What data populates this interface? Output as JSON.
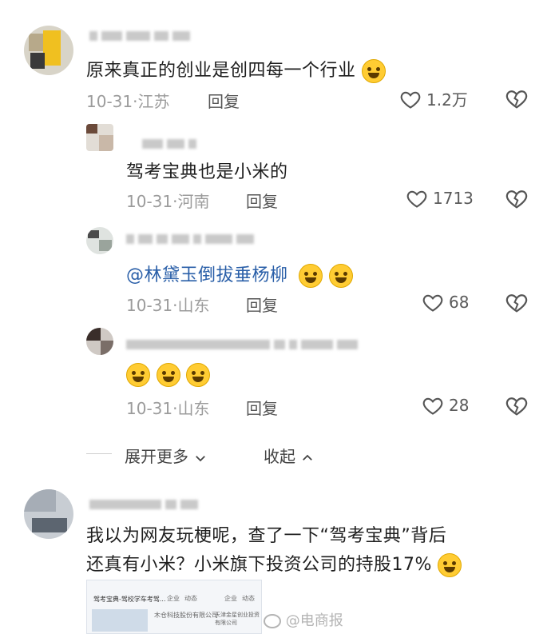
{
  "comments": [
    {
      "text": "原来真正的创业是创四每一个行业",
      "date": "10-31",
      "location": "江苏",
      "reply_label": "回复",
      "likes": "1.2万"
    },
    {
      "text": "驾考宝典也是小米的",
      "date": "10-31",
      "location": "河南",
      "reply_label": "回复",
      "likes": "1713"
    },
    {
      "mention": "@林黛玉倒拔垂杨柳",
      "date": "10-31",
      "location": "山东",
      "reply_label": "回复",
      "likes": "68"
    },
    {
      "date": "10-31",
      "location": "山东",
      "reply_label": "回复",
      "likes": "28"
    },
    {
      "line1": "我以为网友玩梗呢，查了一下“驾考宝典”背后",
      "line2": "还真有小米？小米旗下投资公司的持股17%"
    }
  ],
  "thread": {
    "expand_label": "展开更多",
    "collapse_label": "收起"
  },
  "thumbnail": {
    "title": "驾考宝典-驾校学车考驾...",
    "tabs": [
      "企业",
      "动态",
      "企业",
      "动态"
    ],
    "company1": "木仓科技股份有限公司",
    "company2": "天津金星创业投资有限公司"
  },
  "watermark": "@电商报",
  "icons": [
    "heart-icon",
    "dislike-icon",
    "chevron-down-icon",
    "chevron-up-icon",
    "laugh-cry-emoji",
    "grin-sweat-emoji",
    "dizzy-emoji"
  ]
}
